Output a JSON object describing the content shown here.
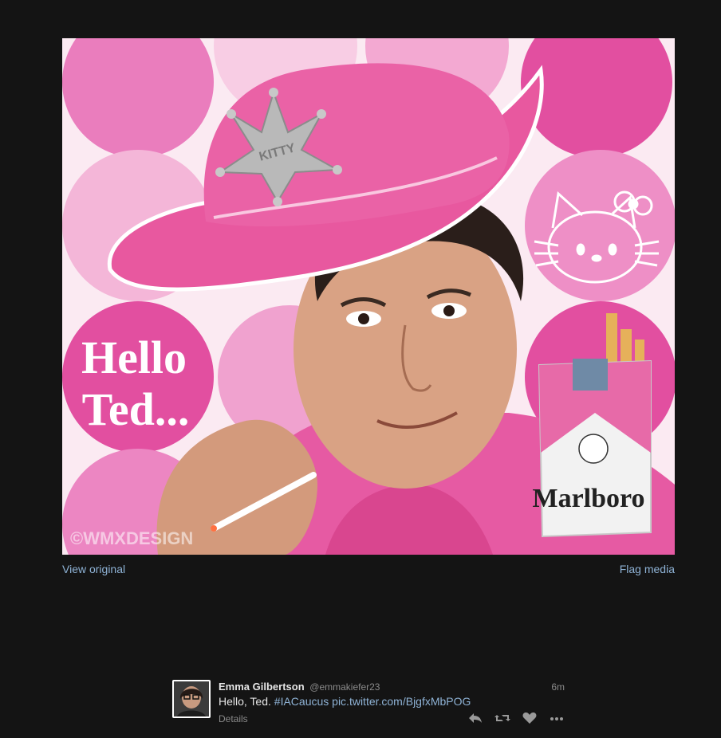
{
  "media": {
    "image_text": {
      "hello": "Hello",
      "ted": "Ted...",
      "badge": "KITTY",
      "brand": "Marlboro",
      "watermark": "©WMXDESIGN"
    },
    "view_original": "View original",
    "flag_media": "Flag media"
  },
  "tweet": {
    "name": "Emma Gilbertson",
    "handle": "@emmakiefer23",
    "time": "6m",
    "text_prefix": "Hello, Ted. ",
    "hashtag": "#IACaucus",
    "link": "pic.twitter.com/BjgfxMbPOG",
    "details": "Details",
    "actions": [
      "reply-icon",
      "retweet-icon",
      "favorite-icon",
      "more-icon"
    ]
  },
  "colors": {
    "background": "#141414",
    "link": "#8fb3d6",
    "pink": "#e94fa3",
    "light_pink": "#f6bfdc"
  }
}
